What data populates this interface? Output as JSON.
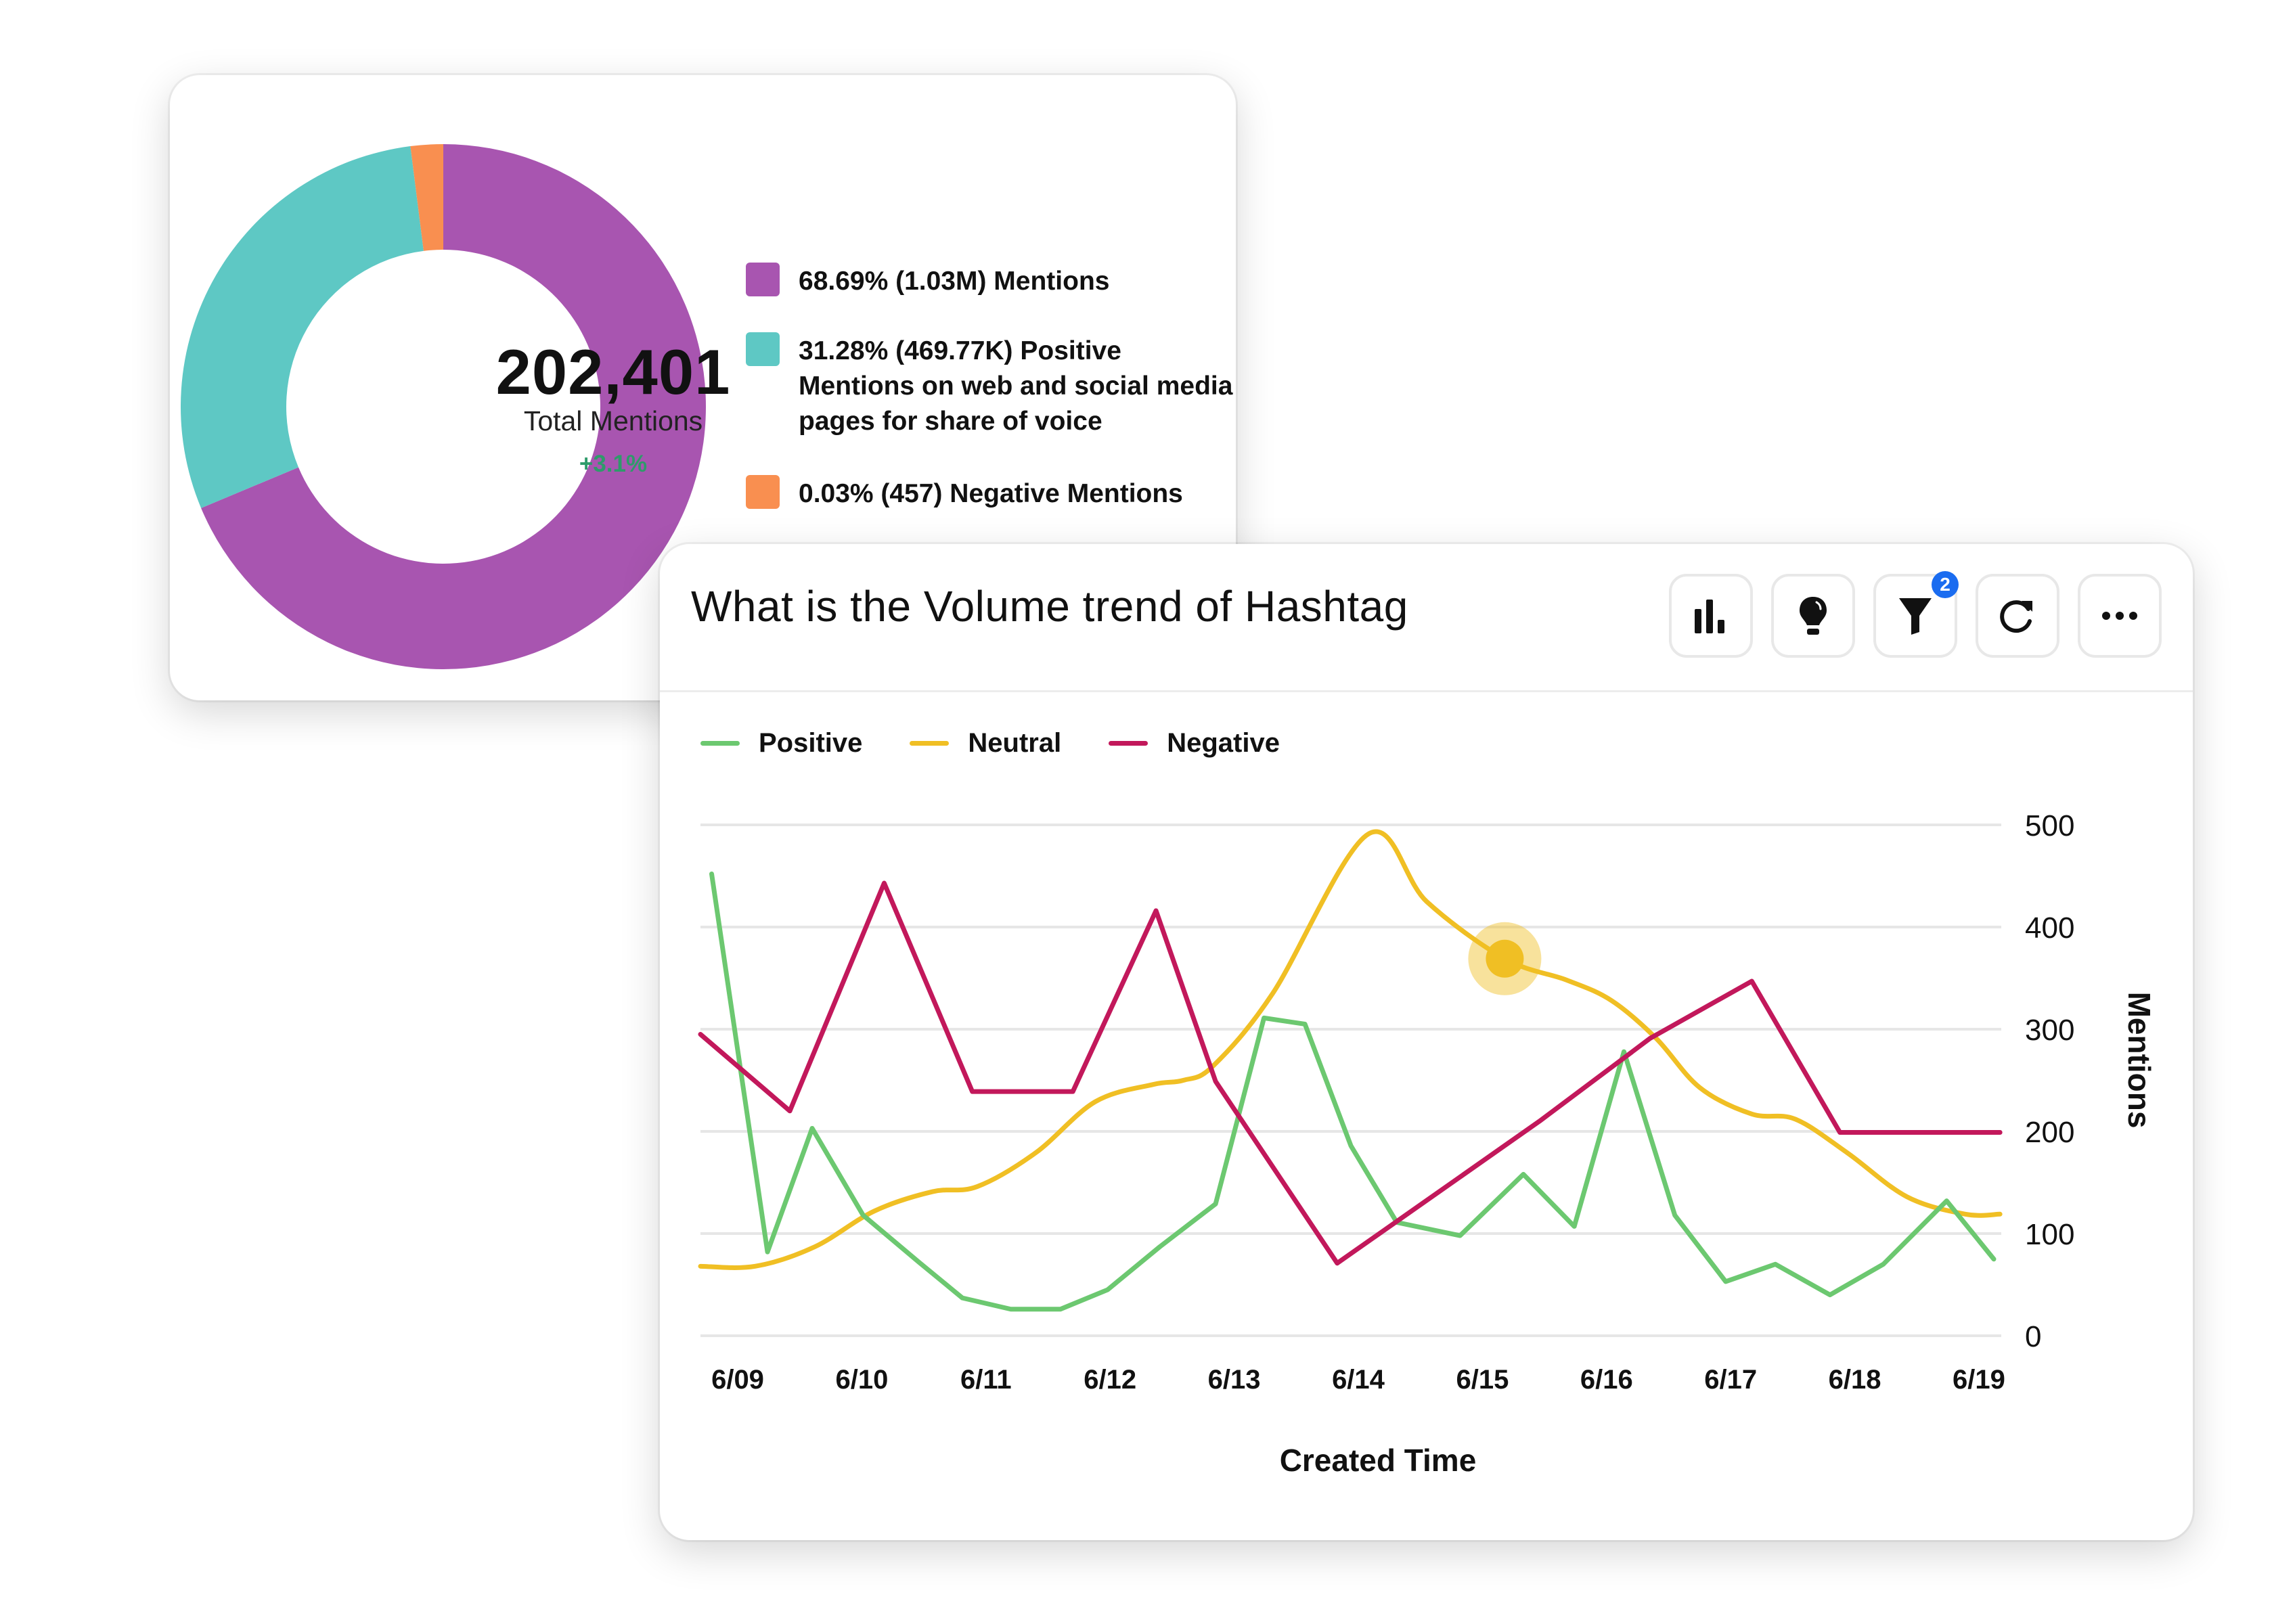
{
  "donut_card": {
    "total_value": "202,401",
    "total_label": "Total Mentions",
    "change": "+3.1%",
    "change_color": "#2e9b6a",
    "legend": [
      {
        "label": "68.69% (1.03M) Mentions",
        "color": "#a855b0"
      },
      {
        "label": "31.28% (469.77K) Positive Mentions on web and social media pages for share of voice",
        "color": "#5ec8c4"
      },
      {
        "label": "0.03% (457) Negative Mentions",
        "color": "#f98f50"
      }
    ]
  },
  "trend_card": {
    "title": "What is the Volume trend of Hashtag",
    "toolbar": [
      {
        "name": "bar-chart-icon"
      },
      {
        "name": "lightbulb-icon"
      },
      {
        "name": "filter-icon",
        "badge": "2"
      },
      {
        "name": "refresh-icon"
      },
      {
        "name": "more-icon"
      }
    ],
    "highlight_color": "#f0bf24"
  },
  "chart_data": [
    {
      "type": "pie",
      "title": "Total Mentions",
      "center_value": "202,401",
      "slices": [
        {
          "label": "Mentions",
          "percent": 68.69,
          "value": "1.03M",
          "color": "#a855b0"
        },
        {
          "label": "Positive Mentions on web and social media pages for share of voice",
          "percent": 31.28,
          "value": "469.77K",
          "color": "#5ec8c4"
        },
        {
          "label": "Negative Mentions",
          "percent": 0.03,
          "value": "457",
          "color": "#f98f50"
        }
      ],
      "visual_slice_fractions": [
        0.6869,
        0.2931,
        0.02
      ],
      "legend_position": "right"
    },
    {
      "type": "line",
      "title": "What is the Volume trend of Hashtag",
      "xlabel": "Created Time",
      "ylabel": "Mentions",
      "x_ticks": [
        "6/09",
        "6/10",
        "6/11",
        "6/12",
        "6/13",
        "6/14",
        "6/15",
        "6/16",
        "6/17",
        "6/18",
        "6/19"
      ],
      "x_range": [
        8.7,
        19.18
      ],
      "ylim": [
        0,
        500
      ],
      "y_ticks": [
        0,
        100,
        200,
        300,
        400,
        500
      ],
      "y_axis_side": "right",
      "grid": true,
      "legend_position": "top-left",
      "series": [
        {
          "name": "Positive",
          "color": "#6cc870",
          "smooth": false,
          "x": [
            8.79,
            9.24,
            9.6,
            10.01,
            10.46,
            10.81,
            11.2,
            11.6,
            11.98,
            12.4,
            12.85,
            13.24,
            13.57,
            13.94,
            14.31,
            14.82,
            15.33,
            15.74,
            16.14,
            16.55,
            16.96,
            17.36,
            17.8,
            18.23,
            18.74,
            19.12
          ],
          "y": [
            452,
            82,
            203,
            118,
            72,
            37,
            26,
            26,
            45,
            87,
            129,
            311,
            305,
            186,
            111,
            98,
            158,
            107,
            278,
            118,
            53,
            70,
            40,
            70,
            132,
            75
          ]
        },
        {
          "name": "Neutral",
          "color": "#f0bf24",
          "smooth": true,
          "x": [
            8.7,
            9.14,
            9.62,
            10.1,
            10.57,
            10.93,
            11.4,
            11.88,
            12.35,
            12.59,
            12.83,
            13.31,
            14.08,
            14.55,
            15.18,
            15.68,
            16.04,
            16.4,
            16.75,
            17.17,
            17.52,
            17.94,
            18.42,
            18.89,
            19.17
          ],
          "y": [
            68,
            68,
            87,
            122,
            141,
            146,
            179,
            229,
            246,
            250,
            264,
            335,
            491,
            425,
            369,
            348,
            328,
            291,
            243,
            217,
            212,
            179,
            136,
            119,
            119
          ]
        },
        {
          "name": "Negative",
          "color": "#c2185b",
          "smooth": false,
          "x": [
            8.7,
            9.42,
            10.18,
            10.89,
            11.7,
            12.37,
            12.85,
            13.83,
            15.46,
            16.35,
            17.17,
            17.88,
            19.17
          ],
          "y": [
            295,
            220,
            443,
            239,
            239,
            416,
            249,
            71,
            210,
            291,
            347,
            199,
            199
          ]
        }
      ],
      "highlighted_point": {
        "series": "Neutral",
        "x_label": "6/15",
        "value": 369
      }
    }
  ]
}
